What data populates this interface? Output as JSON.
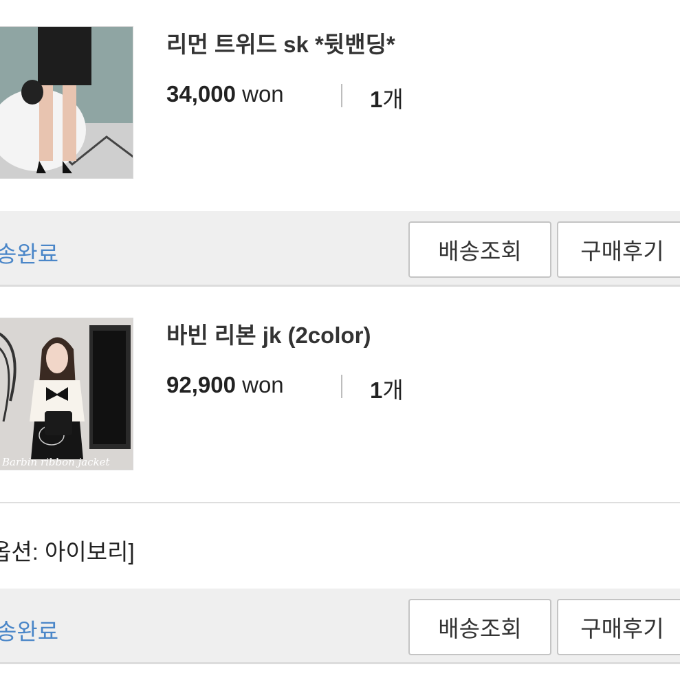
{
  "orders": [
    {
      "product_name": "리먼 트위드 sk *뒷밴딩*",
      "price_amount": "34,000",
      "price_unit": "won",
      "qty_number": "1",
      "qty_unit": "개",
      "status": "송완료",
      "track_button": "배송조회",
      "review_button": "구매후기"
    },
    {
      "product_name": "바빈 리본 jk (2color)",
      "price_amount": "92,900",
      "price_unit": "won",
      "qty_number": "1",
      "qty_unit": "개",
      "option_text": "옵션: 아이보리]",
      "image_caption": "Barbin ribbon jacket",
      "status": "송완료",
      "track_button": "배송조회",
      "review_button": "구매후기"
    }
  ],
  "colors": {
    "status_blue": "#4a86c8",
    "bar_bg": "#efefef"
  }
}
